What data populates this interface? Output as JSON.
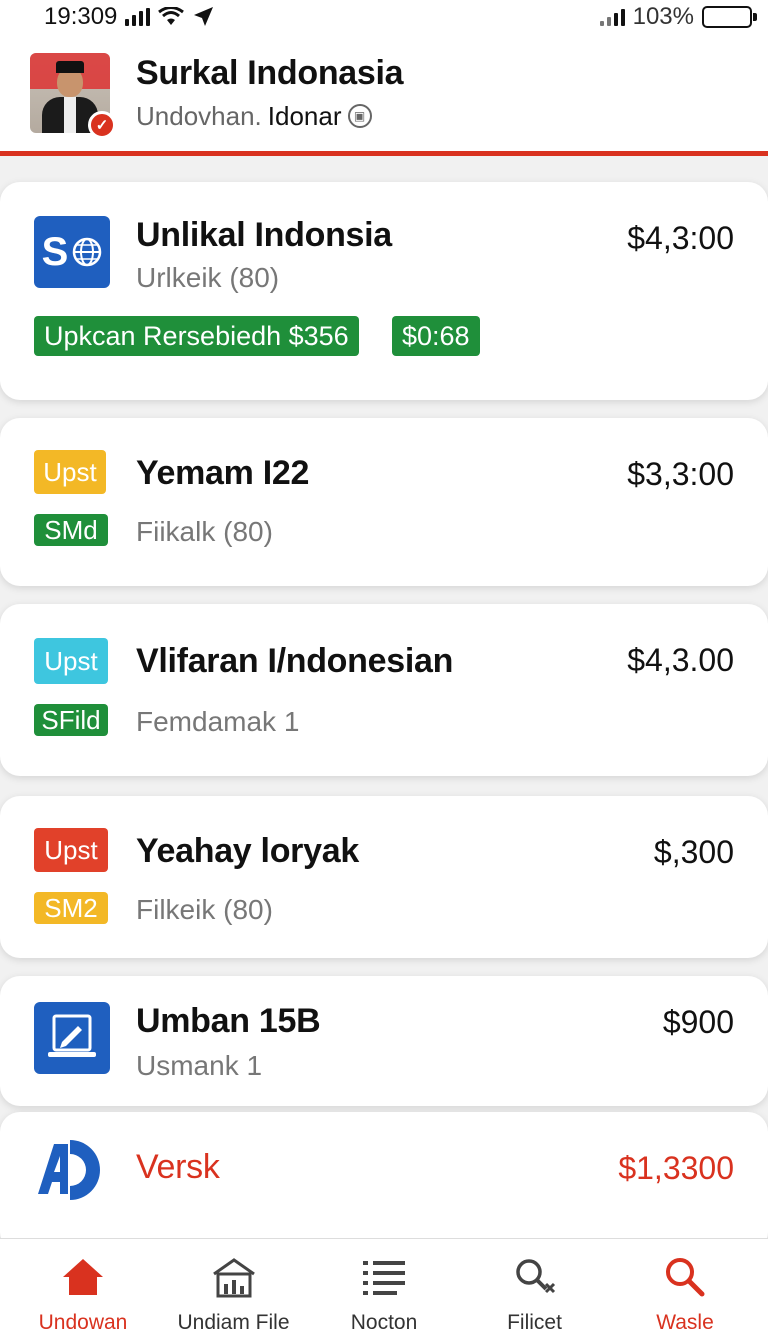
{
  "status_bar": {
    "time": "19:309",
    "battery": "103%"
  },
  "header": {
    "title": "Surkal Indonasia",
    "subtitle_prefix": "Undovhan.",
    "subtitle_strong": "Idonar"
  },
  "items": [
    {
      "title": "Unlikal Indonsia",
      "subtitle": "Urlkeik (80)",
      "price": "$4,3:00",
      "icon": "globe-logo-icon",
      "icon_text": "S",
      "tags": [
        "Upkcan Rersebiedh $356",
        "$0:68"
      ]
    },
    {
      "title": "Yemam I22",
      "badge": "Upst",
      "tag": "SMd",
      "subtitle": "Fiikalk (80)",
      "price": "$3,3:00"
    },
    {
      "title": "Vlifaran I/ndonesian",
      "badge": "Upst",
      "tag": "SFild",
      "subtitle": "Femdamak 1",
      "price": "$4,3.00"
    },
    {
      "title": "Yeahay loryak",
      "badge": "Upst",
      "tag": "SM2",
      "subtitle": "Filkeik (80)",
      "price": "$,300"
    },
    {
      "title": "Umban 15B",
      "subtitle": "Usmank 1",
      "price": "$900",
      "icon": "tablet-edit-icon"
    },
    {
      "title": "Versk",
      "price": "$1,3300",
      "icon": "ad-logo-icon"
    }
  ],
  "colors": {
    "accent": "#d9321f",
    "green": "#1f8f3a",
    "yellow": "#f3b826",
    "cyan": "#3ec6df",
    "blue": "#1f5fbf"
  },
  "nav": [
    {
      "label": "Undowan",
      "icon": "home-icon",
      "active": true
    },
    {
      "label": "Undiam File",
      "icon": "building-chart-icon",
      "active": false
    },
    {
      "label": "Nocton",
      "icon": "list-icon",
      "active": false
    },
    {
      "label": "Filicet",
      "icon": "search-close-icon",
      "active": false
    },
    {
      "label": "Wasle",
      "icon": "search-icon",
      "active": true
    }
  ]
}
